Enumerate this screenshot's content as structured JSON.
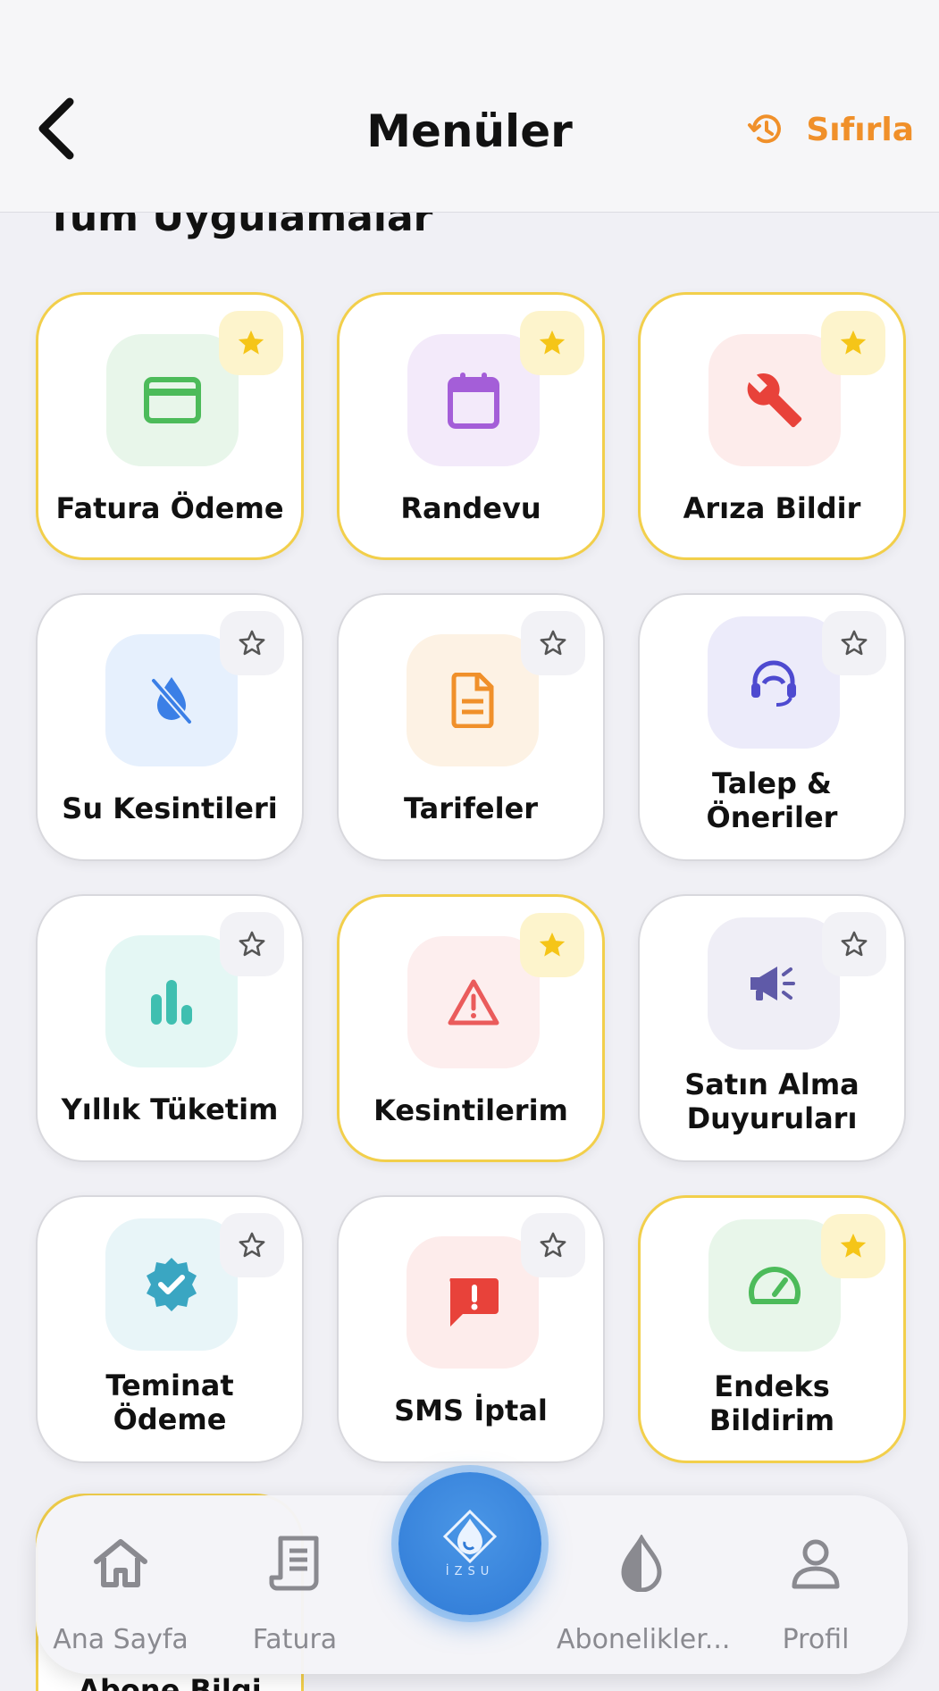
{
  "header": {
    "title": "Menüler",
    "reset_label": "Sıfırla"
  },
  "section_title": "Tüm Uygulamalar",
  "cards": [
    {
      "label": "Fatura Ödeme",
      "favorite": true,
      "icon": "credit-card-icon"
    },
    {
      "label": "Randevu",
      "favorite": true,
      "icon": "calendar-icon"
    },
    {
      "label": "Arıza Bildir",
      "favorite": true,
      "icon": "wrench-icon"
    },
    {
      "label": "Su Kesintileri",
      "favorite": false,
      "icon": "water-off-icon"
    },
    {
      "label": "Tarifeler",
      "favorite": false,
      "icon": "document-icon"
    },
    {
      "label": "Talep & Öneriler",
      "favorite": false,
      "icon": "headset-icon"
    },
    {
      "label": "Yıllık Tüketim",
      "favorite": false,
      "icon": "bar-chart-icon"
    },
    {
      "label": "Kesintilerim",
      "favorite": true,
      "icon": "warning-icon"
    },
    {
      "label": "Satın Alma Duyuruları",
      "favorite": false,
      "icon": "megaphone-icon"
    },
    {
      "label": "Teminat Ödeme",
      "favorite": false,
      "icon": "verified-badge-icon"
    },
    {
      "label": "SMS İptal",
      "favorite": false,
      "icon": "message-alert-icon"
    },
    {
      "label": "Endeks Bildirim",
      "favorite": true,
      "icon": "gauge-icon"
    }
  ],
  "partial_card": {
    "label": "Abone Bilgi"
  },
  "bottom_nav": {
    "items": [
      {
        "label": "Ana Sayfa",
        "icon": "home-icon"
      },
      {
        "label": "Fatura",
        "icon": "receipt-icon"
      },
      {
        "label": "Abonelikler...",
        "icon": "drop-icon"
      },
      {
        "label": "Profil",
        "icon": "user-icon"
      }
    ],
    "center": {
      "label": "İZSU",
      "icon": "izsu-logo-icon"
    }
  },
  "colors": {
    "accent_orange": "#f0902a",
    "favorite_border": "#f2cf4b",
    "star_filled": "#f5c518",
    "brand_blue": "#2f7ad6"
  }
}
